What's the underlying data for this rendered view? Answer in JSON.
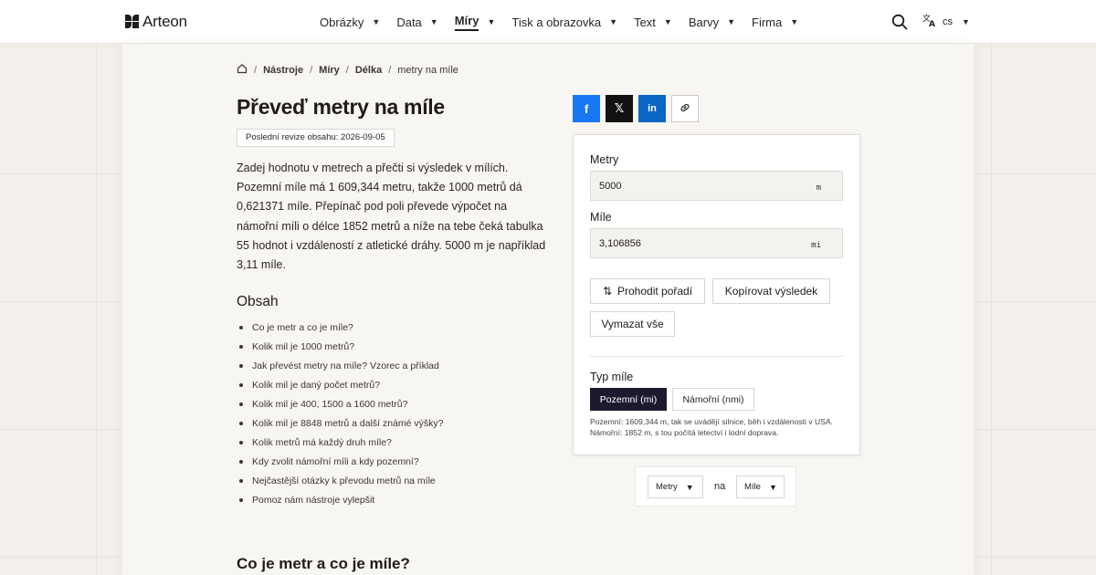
{
  "header": {
    "logo": "Arteon",
    "nav": [
      {
        "label": "Obrázky",
        "active": false
      },
      {
        "label": "Data",
        "active": false
      },
      {
        "label": "Míry",
        "active": true
      },
      {
        "label": "Tisk a obrazovka",
        "active": false
      },
      {
        "label": "Text",
        "active": false
      },
      {
        "label": "Barvy",
        "active": false
      },
      {
        "label": "Firma",
        "active": false
      }
    ],
    "language": "cs"
  },
  "breadcrumb": {
    "items": [
      "Nástroje",
      "Míry",
      "Délka"
    ],
    "current": "metry na míle"
  },
  "page": {
    "title": "Převeď metry na míle",
    "revision": "Poslední revize obsahu: 2026-09-05",
    "intro": "Zadej hodnotu v metrech a přečti si výsledek v mílích. Pozemní míle má 1 609,344 metru, takže 1000 metrů dá 0,621371 míle. Přepínač pod poli převede výpočet na námořní míli o délce 1852 metrů a níže na tebe čeká tabulka 55 hodnot i vzdáleností z atletické dráhy. 5000 m je například 3,11 míle.",
    "toc_title": "Obsah",
    "toc": [
      "Co je metr a co je míle?",
      "Kolik mil je 1000 metrů?",
      "Jak převést metry na míle? Vzorec a příklad",
      "Kolik mil je daný počet metrů?",
      "Kolik mil je 400, 1500 a 1600 metrů?",
      "Kolik mil je 8848 metrů a další známé výšky?",
      "Kolik metrů má každý druh míle?",
      "Kdy zvolit námořní míli a kdy pozemní?",
      "Nejčastější otázky k převodu metrů na míle",
      "Pomoz nám nástroje vylepšit"
    ],
    "section_heading": "Co je metr a co je míle?"
  },
  "share": {
    "facebook": "f",
    "x": "𝕏",
    "linkedin": "in"
  },
  "converter": {
    "meters_label": "Metry",
    "meters_value": "5000",
    "meters_unit": "m",
    "miles_label": "Míle",
    "miles_value": "3,106856",
    "miles_unit": "mi",
    "swap_label": "Prohodit pořadí",
    "copy_label": "Kopírovat výsledek",
    "clear_label": "Vymazat vše",
    "type_label": "Typ míle",
    "type_land": "Pozemní (mi)",
    "type_nautical": "Námořní (nmi)",
    "note": "Pozemní: 1609,344 m, tak se uvádějí silnice, běh i vzdálenosti v USA. Námořní: 1852 m, s tou počítá letectví i lodní doprava."
  },
  "unit_selector": {
    "from": "Metry",
    "joiner": "na",
    "to": "Míle"
  },
  "colors": {
    "accent_dark": "#1d1a2e",
    "facebook": "#1877f2",
    "linkedin": "#0a66c2"
  }
}
